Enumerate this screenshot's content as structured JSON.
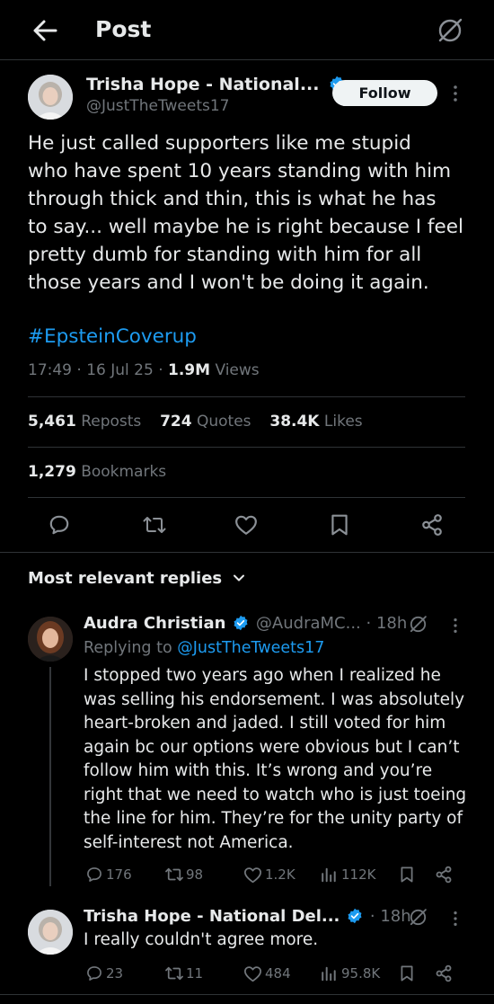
{
  "header": {
    "title": "Post"
  },
  "post": {
    "author_name": "Trisha Hope - National...",
    "author_handle": "@JustTheTweets17",
    "follow_label": "Follow",
    "text_lines": [
      "He just called supporters like me stupid",
      "who have spent 10 years standing with him",
      "through thick and thin, this is what he has",
      "to say... well maybe he is right because I feel",
      "pretty dumb for standing with him for all",
      "those years and I won't be doing it again."
    ],
    "hashtag": "#EpsteinCoverup",
    "timestamp": "17:49 · 16 Jul 25 · ",
    "views_count": "1.9M",
    "views_label": " Views",
    "reposts_count": "5,461",
    "reposts_label": "Reposts",
    "quotes_count": "724",
    "quotes_label": "Quotes",
    "likes_count": "38.4K",
    "likes_label": "Likes",
    "bookmarks_count": "1,279",
    "bookmarks_label": "Bookmarks"
  },
  "replies_header": {
    "label": "Most relevant replies"
  },
  "replies": [
    {
      "author_name": "Audra Christian",
      "author_handle": "@AudraMC...",
      "time": "· 18h",
      "replying_prefix": "Replying to ",
      "replying_handle": "@JustTheTweets17",
      "text_lines": [
        "I stopped two years ago when I realized he",
        "was selling his endorsement. I was absolutely",
        "heart-broken and jaded. I still voted for him",
        "again bc our options were obvious but I can’t",
        "follow him with this. It’s wrong and you’re",
        "right that we need to watch who is just toeing",
        "the line for him. They’re for the unity party of",
        "self-interest not America."
      ],
      "replies_count": "176",
      "reposts_count": "98",
      "likes_count": "1.2K",
      "views_count": "112K"
    },
    {
      "author_name": "Trisha Hope - National Del...",
      "time": "· 18h",
      "text": "I really couldn't agree more.",
      "replies_count": "23",
      "reposts_count": "11",
      "likes_count": "484",
      "views_count": "95.8K"
    }
  ],
  "icons": {
    "back": "arrow-left-icon",
    "grok": "grok-icon",
    "more": "more-vertical-icon",
    "verified": "verified-badge-icon",
    "reply": "reply-icon",
    "repost": "repost-icon",
    "like": "heart-icon",
    "bookmark": "bookmark-icon",
    "share": "share-icon",
    "views": "views-bar-icon",
    "chevron": "chevron-down-icon"
  },
  "colors": {
    "background": "#000000",
    "text": "#e7e9ea",
    "muted": "#71767b",
    "accent": "#1d9bf0",
    "divider": "#2f3336"
  }
}
